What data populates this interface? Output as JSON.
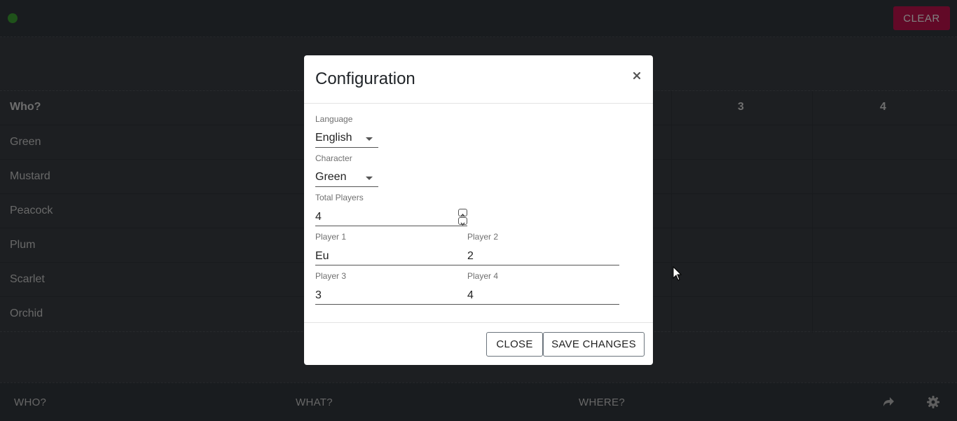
{
  "topbar": {
    "clear_label": "CLEAR",
    "status_color": "#3fa535"
  },
  "table": {
    "header_label": "Who?",
    "columns": [
      "3",
      "4"
    ],
    "rows": [
      "Green",
      "Mustard",
      "Peacock",
      "Plum",
      "Scarlet",
      "Orchid"
    ]
  },
  "bottombar": {
    "who_label": "WHO?",
    "what_label": "WHAT?",
    "where_label": "WHERE?",
    "icons": [
      "share-icon",
      "gear-icon"
    ]
  },
  "modal": {
    "title": "Configuration",
    "close_symbol": "×",
    "language": {
      "label": "Language",
      "value": "English"
    },
    "character": {
      "label": "Character",
      "value": "Green"
    },
    "total_players": {
      "label": "Total Players",
      "value": "4"
    },
    "players": [
      {
        "label": "Player 1",
        "value": "Eu"
      },
      {
        "label": "Player 2",
        "value": "2"
      },
      {
        "label": "Player 3",
        "value": "3"
      },
      {
        "label": "Player 4",
        "value": "4"
      }
    ],
    "close_label": "CLOSE",
    "save_label": "SAVE CHANGES"
  },
  "colors": {
    "accent": "#c4134e",
    "background": "#3a3f45"
  }
}
